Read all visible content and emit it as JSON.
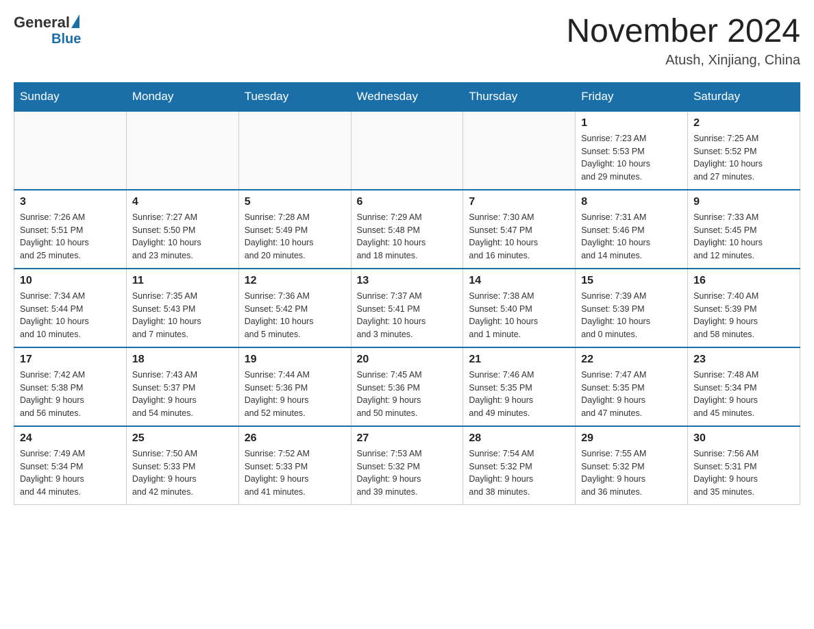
{
  "header": {
    "logo_general": "General",
    "logo_blue": "Blue",
    "month_title": "November 2024",
    "location": "Atush, Xinjiang, China"
  },
  "days_of_week": [
    "Sunday",
    "Monday",
    "Tuesday",
    "Wednesday",
    "Thursday",
    "Friday",
    "Saturday"
  ],
  "weeks": [
    [
      {
        "day": "",
        "info": ""
      },
      {
        "day": "",
        "info": ""
      },
      {
        "day": "",
        "info": ""
      },
      {
        "day": "",
        "info": ""
      },
      {
        "day": "",
        "info": ""
      },
      {
        "day": "1",
        "info": "Sunrise: 7:23 AM\nSunset: 5:53 PM\nDaylight: 10 hours\nand 29 minutes."
      },
      {
        "day": "2",
        "info": "Sunrise: 7:25 AM\nSunset: 5:52 PM\nDaylight: 10 hours\nand 27 minutes."
      }
    ],
    [
      {
        "day": "3",
        "info": "Sunrise: 7:26 AM\nSunset: 5:51 PM\nDaylight: 10 hours\nand 25 minutes."
      },
      {
        "day": "4",
        "info": "Sunrise: 7:27 AM\nSunset: 5:50 PM\nDaylight: 10 hours\nand 23 minutes."
      },
      {
        "day": "5",
        "info": "Sunrise: 7:28 AM\nSunset: 5:49 PM\nDaylight: 10 hours\nand 20 minutes."
      },
      {
        "day": "6",
        "info": "Sunrise: 7:29 AM\nSunset: 5:48 PM\nDaylight: 10 hours\nand 18 minutes."
      },
      {
        "day": "7",
        "info": "Sunrise: 7:30 AM\nSunset: 5:47 PM\nDaylight: 10 hours\nand 16 minutes."
      },
      {
        "day": "8",
        "info": "Sunrise: 7:31 AM\nSunset: 5:46 PM\nDaylight: 10 hours\nand 14 minutes."
      },
      {
        "day": "9",
        "info": "Sunrise: 7:33 AM\nSunset: 5:45 PM\nDaylight: 10 hours\nand 12 minutes."
      }
    ],
    [
      {
        "day": "10",
        "info": "Sunrise: 7:34 AM\nSunset: 5:44 PM\nDaylight: 10 hours\nand 10 minutes."
      },
      {
        "day": "11",
        "info": "Sunrise: 7:35 AM\nSunset: 5:43 PM\nDaylight: 10 hours\nand 7 minutes."
      },
      {
        "day": "12",
        "info": "Sunrise: 7:36 AM\nSunset: 5:42 PM\nDaylight: 10 hours\nand 5 minutes."
      },
      {
        "day": "13",
        "info": "Sunrise: 7:37 AM\nSunset: 5:41 PM\nDaylight: 10 hours\nand 3 minutes."
      },
      {
        "day": "14",
        "info": "Sunrise: 7:38 AM\nSunset: 5:40 PM\nDaylight: 10 hours\nand 1 minute."
      },
      {
        "day": "15",
        "info": "Sunrise: 7:39 AM\nSunset: 5:39 PM\nDaylight: 10 hours\nand 0 minutes."
      },
      {
        "day": "16",
        "info": "Sunrise: 7:40 AM\nSunset: 5:39 PM\nDaylight: 9 hours\nand 58 minutes."
      }
    ],
    [
      {
        "day": "17",
        "info": "Sunrise: 7:42 AM\nSunset: 5:38 PM\nDaylight: 9 hours\nand 56 minutes."
      },
      {
        "day": "18",
        "info": "Sunrise: 7:43 AM\nSunset: 5:37 PM\nDaylight: 9 hours\nand 54 minutes."
      },
      {
        "day": "19",
        "info": "Sunrise: 7:44 AM\nSunset: 5:36 PM\nDaylight: 9 hours\nand 52 minutes."
      },
      {
        "day": "20",
        "info": "Sunrise: 7:45 AM\nSunset: 5:36 PM\nDaylight: 9 hours\nand 50 minutes."
      },
      {
        "day": "21",
        "info": "Sunrise: 7:46 AM\nSunset: 5:35 PM\nDaylight: 9 hours\nand 49 minutes."
      },
      {
        "day": "22",
        "info": "Sunrise: 7:47 AM\nSunset: 5:35 PM\nDaylight: 9 hours\nand 47 minutes."
      },
      {
        "day": "23",
        "info": "Sunrise: 7:48 AM\nSunset: 5:34 PM\nDaylight: 9 hours\nand 45 minutes."
      }
    ],
    [
      {
        "day": "24",
        "info": "Sunrise: 7:49 AM\nSunset: 5:34 PM\nDaylight: 9 hours\nand 44 minutes."
      },
      {
        "day": "25",
        "info": "Sunrise: 7:50 AM\nSunset: 5:33 PM\nDaylight: 9 hours\nand 42 minutes."
      },
      {
        "day": "26",
        "info": "Sunrise: 7:52 AM\nSunset: 5:33 PM\nDaylight: 9 hours\nand 41 minutes."
      },
      {
        "day": "27",
        "info": "Sunrise: 7:53 AM\nSunset: 5:32 PM\nDaylight: 9 hours\nand 39 minutes."
      },
      {
        "day": "28",
        "info": "Sunrise: 7:54 AM\nSunset: 5:32 PM\nDaylight: 9 hours\nand 38 minutes."
      },
      {
        "day": "29",
        "info": "Sunrise: 7:55 AM\nSunset: 5:32 PM\nDaylight: 9 hours\nand 36 minutes."
      },
      {
        "day": "30",
        "info": "Sunrise: 7:56 AM\nSunset: 5:31 PM\nDaylight: 9 hours\nand 35 minutes."
      }
    ]
  ]
}
